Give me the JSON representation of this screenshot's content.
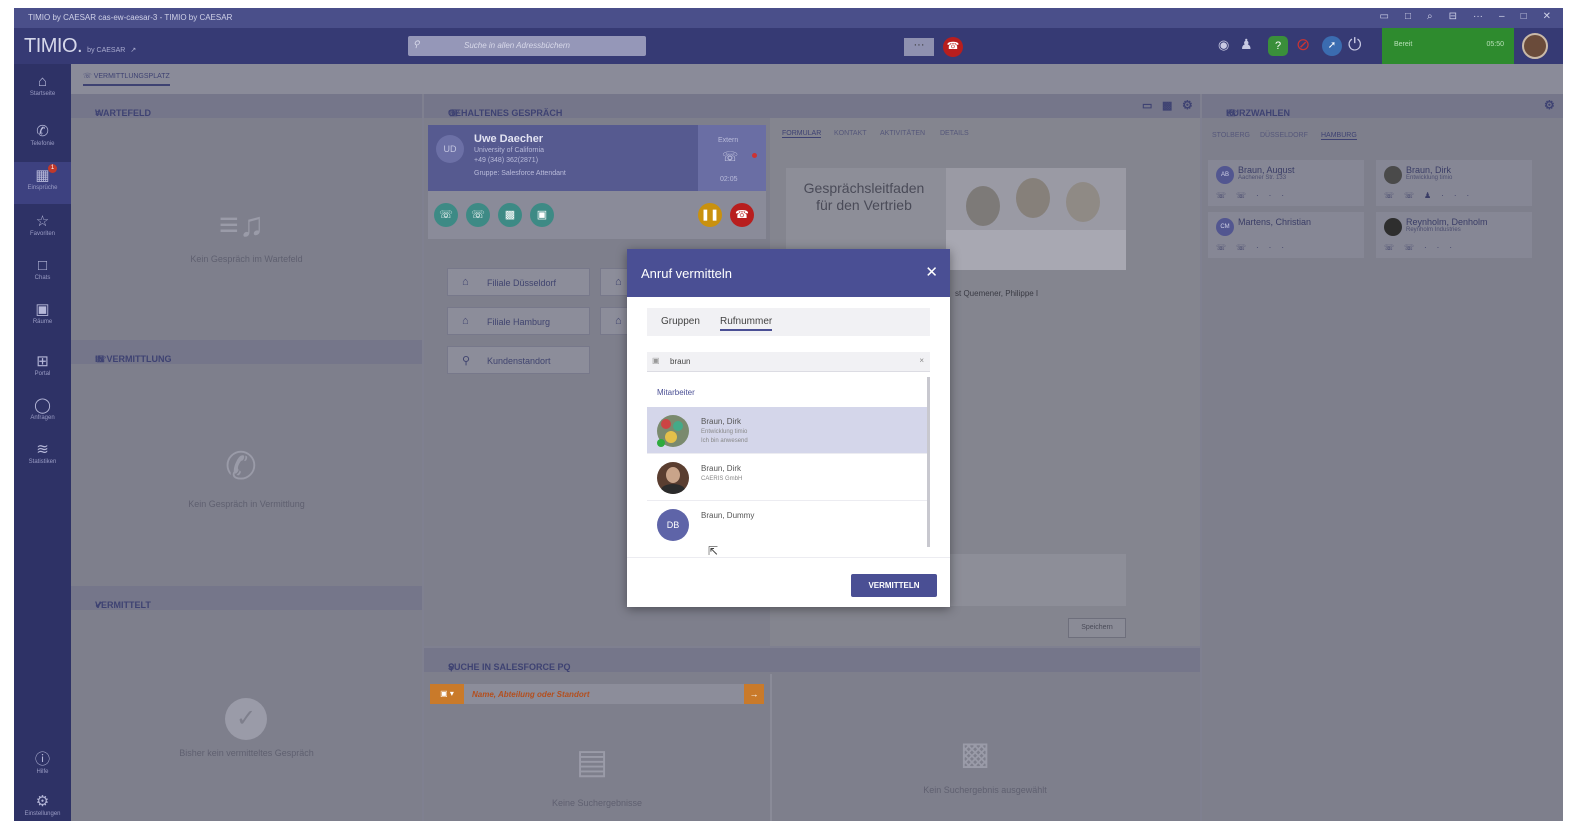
{
  "window": {
    "title": "TIMIO by CAESAR cas-ew-caesar-3 - TIMIO by CAESAR",
    "controls": [
      "▭",
      "□",
      "⌕",
      "⊟",
      "···",
      "–",
      "□",
      "✕"
    ]
  },
  "appbar": {
    "logo": "TIMIO.",
    "logo_sub": "by CAESAR",
    "search_placeholder": "Suche in allen Adressbüchern",
    "status_label": "Bereit",
    "status_time": "05:50",
    "accent_color": "#363a74",
    "status_color": "#2e8b2e"
  },
  "sidebar": {
    "items": [
      {
        "icon": "home-icon",
        "label": "Startseite"
      },
      {
        "icon": "phone-icon",
        "label": "Telefonie"
      },
      {
        "icon": "calendar-icon",
        "label": "Einsprüche",
        "badge": "1"
      },
      {
        "icon": "star-icon",
        "label": "Favoriten"
      },
      {
        "icon": "chat-icon",
        "label": "Chats"
      },
      {
        "icon": "rooms-icon",
        "label": "Räume"
      },
      {
        "icon": "grid-icon",
        "label": "Portal"
      },
      {
        "icon": "requests-icon",
        "label": "Anfragen"
      },
      {
        "icon": "stats-icon",
        "label": "Statistiken"
      }
    ],
    "bottom": [
      {
        "icon": "help-icon",
        "label": "Hilfe"
      },
      {
        "icon": "gear-icon",
        "label": "Einstellungen"
      }
    ]
  },
  "main_tab": "VERMITTLUNGSPLATZ",
  "wartefeld": {
    "title": "WARTEFELD",
    "empty": "Kein Gespräch im Wartefeld"
  },
  "in_vermittlung": {
    "title": "IN VERMITTLUNG",
    "empty": "Kein Gespräch in Vermittlung"
  },
  "vermittelt": {
    "title": "VERMITTELT",
    "empty": "Bisher kein vermitteltes Gespräch"
  },
  "gehaltenes": {
    "title": "GEHALTENES GESPRÄCH",
    "caller": {
      "initials": "UD",
      "name": "Uwe Daecher",
      "org": "University of California",
      "phone": "+49 (348) 362(2871)",
      "group": "Gruppe: Salesforce Attendant",
      "extra_label": "Extern",
      "duration": "02:05"
    },
    "locations": [
      "Filiale Düsseldorf",
      "Filiale Hamburg",
      "Kundenstandort"
    ],
    "detail_tabs": [
      "FORMULAR",
      "KONTAKT",
      "AKTIVITÄTEN",
      "DETAILS"
    ],
    "guide_text": "Gesprächsleitfaden für den Vertrieb",
    "contact_fragment": "st Quemener, Philippe I",
    "save_label": "Speichern"
  },
  "kurzwahlen": {
    "title": "KURZWAHLEN",
    "tabs": [
      "STOLBERG",
      "DÜSSELDORF",
      "HAMBURG"
    ],
    "entries": [
      {
        "initials": "AB",
        "name": "Braun, August",
        "sub": "Aachener Str. 133"
      },
      {
        "initials": "",
        "name": "Braun, Dirk",
        "sub": "Entwicklung timio"
      },
      {
        "initials": "CM",
        "name": "Martens, Christian",
        "sub": ""
      },
      {
        "initials": "",
        "name": "Reynholm, Denholm",
        "sub": "Reynholm Industries"
      }
    ]
  },
  "suche": {
    "title": "SUCHE IN SALESFORCE PQ",
    "placeholder": "Name, Abteilung oder Standort",
    "empty_left": "Keine Suchergebnisse",
    "empty_right": "Kein Suchergebnis ausgewählt"
  },
  "modal": {
    "title": "Anruf vermitteln",
    "tabs": [
      "Gruppen",
      "Rufnummer"
    ],
    "active_tab": "Rufnummer",
    "search_value": "braun",
    "section": "Mitarbeiter",
    "results": [
      {
        "name": "Braun, Dirk",
        "line1": "Entwicklung timio",
        "line2": "Ich bin anwesend",
        "selected": true
      },
      {
        "name": "Braun, Dirk",
        "line1": "CAERIS GmbH",
        "line2": "",
        "selected": false
      },
      {
        "name": "Braun, Dummy",
        "initials": "DB",
        "line1": "",
        "line2": "",
        "selected": false
      }
    ],
    "confirm_label": "VERMITTELN"
  }
}
